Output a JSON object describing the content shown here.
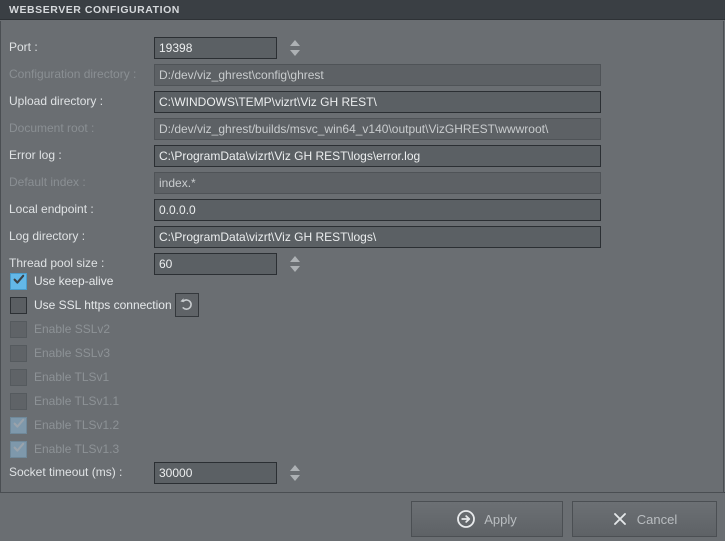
{
  "titlebar": {
    "title": "WEBSERVER CONFIGURATION"
  },
  "form": {
    "rows": [
      {
        "label": "Port :",
        "value": "19398",
        "enabled": true,
        "spinner": true,
        "width": "narrow"
      },
      {
        "label": "Configuration directory :",
        "value": "D:/dev/viz_ghrest\\config\\ghrest",
        "enabled": false,
        "spinner": false,
        "width": "wide"
      },
      {
        "label": "Upload directory :",
        "value": "C:\\WINDOWS\\TEMP\\vizrt\\Viz GH REST\\",
        "enabled": true,
        "spinner": false,
        "width": "wide"
      },
      {
        "label": "Document root :",
        "value": "D:/dev/viz_ghrest/builds/msvc_win64_v140\\output\\VizGHREST\\wwwroot\\",
        "enabled": false,
        "spinner": false,
        "width": "wide"
      },
      {
        "label": "Error log :",
        "value": "C:\\ProgramData\\vizrt\\Viz GH REST\\logs\\error.log",
        "enabled": true,
        "spinner": false,
        "width": "wide"
      },
      {
        "label": "Default index :",
        "value": "index.*",
        "enabled": false,
        "spinner": false,
        "width": "wide"
      },
      {
        "label": "Local endpoint :",
        "value": "0.0.0.0",
        "enabled": true,
        "spinner": false,
        "width": "wide"
      },
      {
        "label": "Log directory :",
        "value": "C:\\ProgramData\\vizrt\\Viz GH REST\\logs\\",
        "enabled": true,
        "spinner": false,
        "width": "wide"
      },
      {
        "label": "Thread pool size :",
        "value": "60",
        "enabled": true,
        "spinner": true,
        "width": "narrow"
      }
    ],
    "socket_timeout": {
      "label": "Socket timeout (ms) :",
      "value": "30000",
      "enabled": true,
      "spinner": true,
      "width": "narrow"
    }
  },
  "checkboxes": [
    {
      "label": "Use keep-alive",
      "checked": true,
      "enabled": true
    },
    {
      "label": "Use SSL https connection",
      "checked": false,
      "enabled": true
    },
    {
      "label": "Enable SSLv2",
      "checked": false,
      "enabled": false
    },
    {
      "label": "Enable SSLv3",
      "checked": false,
      "enabled": false
    },
    {
      "label": "Enable TLSv1",
      "checked": false,
      "enabled": false
    },
    {
      "label": "Enable TLSv1.1",
      "checked": false,
      "enabled": false
    },
    {
      "label": "Enable TLSv1.2",
      "checked": true,
      "enabled": false
    },
    {
      "label": "Enable TLSv1.3",
      "checked": true,
      "enabled": false
    }
  ],
  "reset_button": {
    "icon": "undo-arrow-icon"
  },
  "footer": {
    "apply_label": "Apply",
    "cancel_label": "Cancel"
  },
  "colors": {
    "titlebar_bg": "#3a3f44",
    "panel_bg": "#6a6e72",
    "checkbox_accent": "#63b8e8",
    "checkbox_disabled_accent": "#7e98ab",
    "field_enabled_bg": "#5b6064",
    "field_disabled_bg": "#5d6165"
  }
}
